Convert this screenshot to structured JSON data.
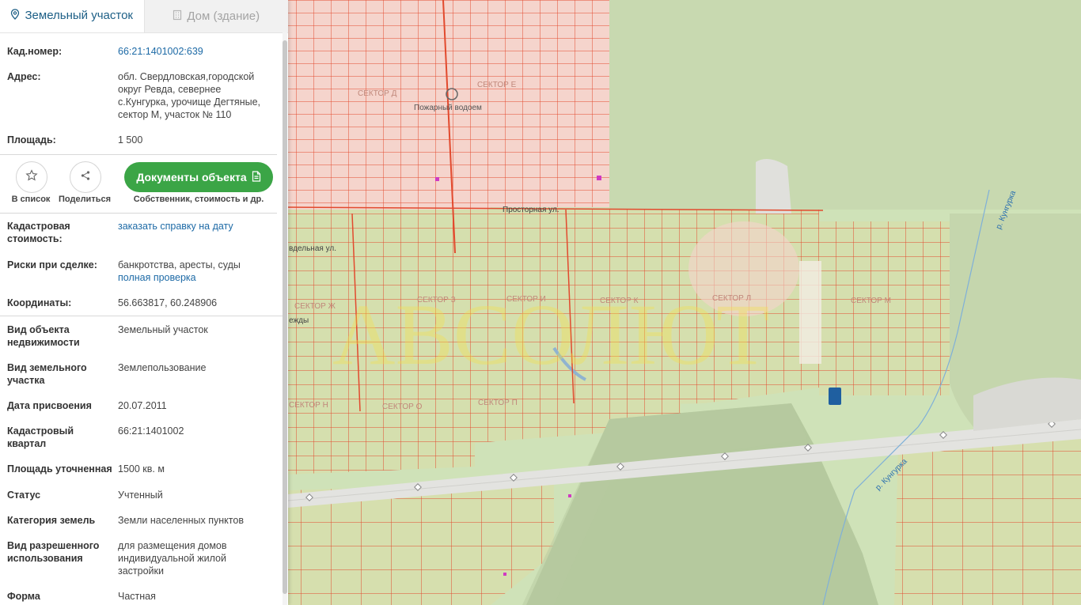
{
  "tabs": {
    "land": "Земельный участок",
    "house": "Дом (здание)"
  },
  "info": {
    "cad_number_label": "Кад.номер:",
    "cad_number": "66:21:1401002:639",
    "address_label": "Адрес:",
    "address": "обл. Свердловская,городской округ Ревда, севернее с.Кунгурка, урочище Дегтяные, сектор М, участок № 110",
    "area_label": "Площадь:",
    "area": "1 500"
  },
  "actions": {
    "add_list": "В список",
    "share": "Поделиться",
    "documents": "Документы объекта",
    "documents_sub": "Собственник, стоимость и др."
  },
  "details": {
    "cad_cost_label": "Кадастровая стоимость:",
    "cad_cost_link": "заказать справку на дату",
    "risks_label": "Риски при сделке:",
    "risks_text": "банкротства, аресты, суды",
    "risks_link": "полная проверка",
    "coords_label": "Координаты:",
    "coords": "56.663817, 60.248906",
    "object_type_label": "Вид объекта недвижимости",
    "object_type": "Земельный участок",
    "land_type_label": "Вид земельного участка",
    "land_type": "Землепользование",
    "date_label": "Дата присвоения",
    "date": "20.07.2011",
    "quarter_label": "Кадастровый квартал",
    "quarter": "66:21:1401002",
    "area_precise_label": "Площадь уточненная",
    "area_precise": "1500 кв. м",
    "status_label": "Статус",
    "status": "Учтенный",
    "category_label": "Категория земель",
    "category": "Земли населенных пунктов",
    "usage_label": "Вид разрешенного использования",
    "usage": "для размещения домов индивидуальной жилой застройки",
    "form_label": "Форма",
    "form": "Частная"
  },
  "map_labels": {
    "sector_d": "СЕКТОР Д",
    "sector_e": "СЕКТОР Е",
    "fire_pond": "Пожарный водоем",
    "prostornaya": "Просторная ул.",
    "sector_zh": "СЕКТОР Ж",
    "sector_z": "СЕКТОР З",
    "sector_i": "СЕКТОР И",
    "sector_k": "СЕКТОР К",
    "sector_l": "СЕКТОР Л",
    "sector_m": "СЕКТОР М",
    "sector_n": "СЕКТОР Н",
    "sector_o": "СЕКТОР О",
    "sector_p": "СЕКТОР П",
    "street_a": "вдельная ул.",
    "street_b": "ежды",
    "river_1": "р. Кунгурка",
    "river_2": "р. Кунгурка"
  },
  "colors": {
    "accent": "#1d5f86",
    "button": "#3ba546",
    "parcel_line": "#e24a2e"
  }
}
